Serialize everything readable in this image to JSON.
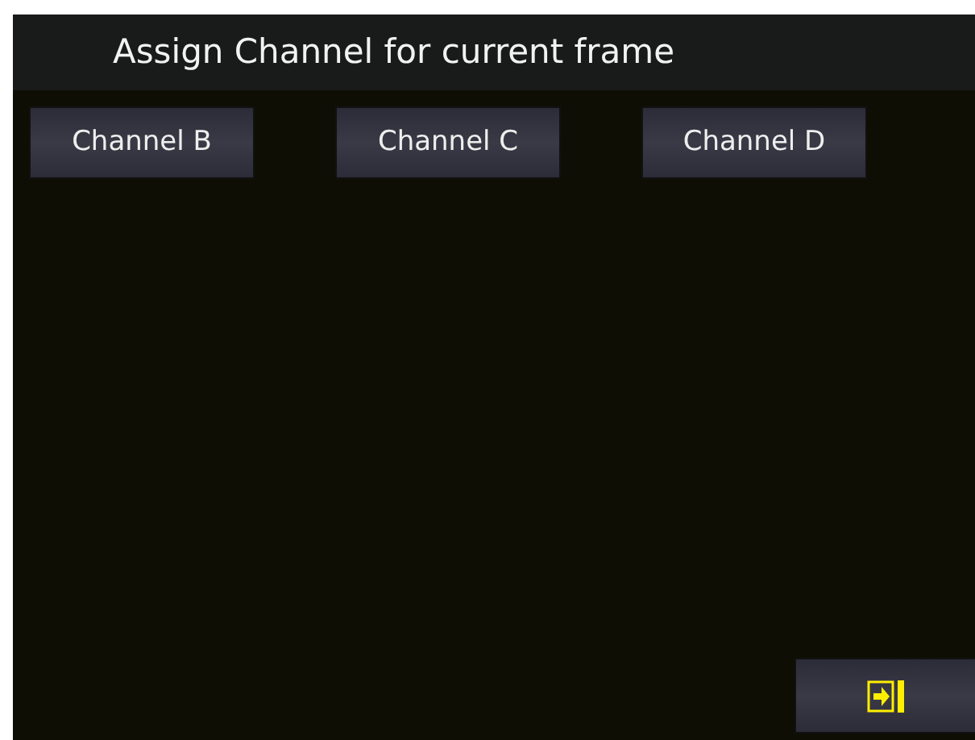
{
  "title": "Assign Channel for current frame",
  "channels": [
    {
      "label": "Channel B"
    },
    {
      "label": "Channel C"
    },
    {
      "label": "Channel D"
    }
  ]
}
